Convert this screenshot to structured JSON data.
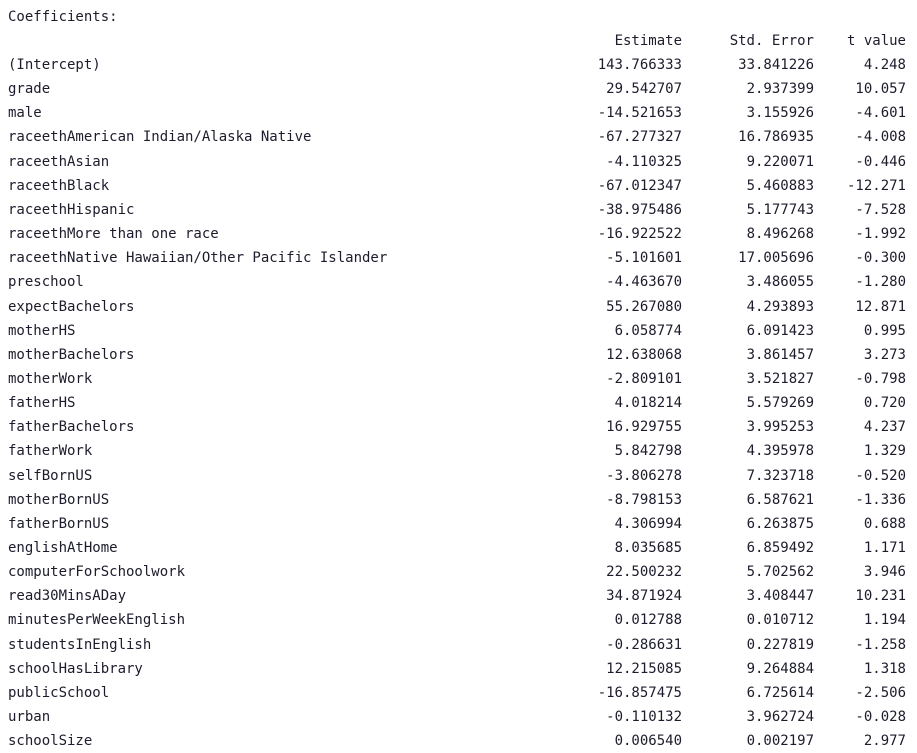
{
  "output": {
    "heading": "Coefficients:",
    "columns": {
      "estimate": "Estimate",
      "std_error": "Std. Error",
      "t_value": "t value"
    },
    "rows": [
      {
        "term": "(Intercept)",
        "estimate": "143.766333",
        "std_error": "33.841226",
        "t_value": "4.248"
      },
      {
        "term": "grade",
        "estimate": "29.542707",
        "std_error": "2.937399",
        "t_value": "10.057"
      },
      {
        "term": "male",
        "estimate": "-14.521653",
        "std_error": "3.155926",
        "t_value": "-4.601"
      },
      {
        "term": "raceethAmerican Indian/Alaska Native",
        "estimate": "-67.277327",
        "std_error": "16.786935",
        "t_value": "-4.008"
      },
      {
        "term": "raceethAsian",
        "estimate": "-4.110325",
        "std_error": "9.220071",
        "t_value": "-0.446"
      },
      {
        "term": "raceethBlack",
        "estimate": "-67.012347",
        "std_error": "5.460883",
        "t_value": "-12.271"
      },
      {
        "term": "raceethHispanic",
        "estimate": "-38.975486",
        "std_error": "5.177743",
        "t_value": "-7.528"
      },
      {
        "term": "raceethMore than one race",
        "estimate": "-16.922522",
        "std_error": "8.496268",
        "t_value": "-1.992"
      },
      {
        "term": "raceethNative Hawaiian/Other Pacific Islander",
        "estimate": "-5.101601",
        "std_error": "17.005696",
        "t_value": "-0.300"
      },
      {
        "term": "preschool",
        "estimate": "-4.463670",
        "std_error": "3.486055",
        "t_value": "-1.280"
      },
      {
        "term": "expectBachelors",
        "estimate": "55.267080",
        "std_error": "4.293893",
        "t_value": "12.871"
      },
      {
        "term": "motherHS",
        "estimate": "6.058774",
        "std_error": "6.091423",
        "t_value": "0.995"
      },
      {
        "term": "motherBachelors",
        "estimate": "12.638068",
        "std_error": "3.861457",
        "t_value": "3.273"
      },
      {
        "term": "motherWork",
        "estimate": "-2.809101",
        "std_error": "3.521827",
        "t_value": "-0.798"
      },
      {
        "term": "fatherHS",
        "estimate": "4.018214",
        "std_error": "5.579269",
        "t_value": "0.720"
      },
      {
        "term": "fatherBachelors",
        "estimate": "16.929755",
        "std_error": "3.995253",
        "t_value": "4.237"
      },
      {
        "term": "fatherWork",
        "estimate": "5.842798",
        "std_error": "4.395978",
        "t_value": "1.329"
      },
      {
        "term": "selfBornUS",
        "estimate": "-3.806278",
        "std_error": "7.323718",
        "t_value": "-0.520"
      },
      {
        "term": "motherBornUS",
        "estimate": "-8.798153",
        "std_error": "6.587621",
        "t_value": "-1.336"
      },
      {
        "term": "fatherBornUS",
        "estimate": "4.306994",
        "std_error": "6.263875",
        "t_value": "0.688"
      },
      {
        "term": "englishAtHome",
        "estimate": "8.035685",
        "std_error": "6.859492",
        "t_value": "1.171"
      },
      {
        "term": "computerForSchoolwork",
        "estimate": "22.500232",
        "std_error": "5.702562",
        "t_value": "3.946"
      },
      {
        "term": "read30MinsADay",
        "estimate": "34.871924",
        "std_error": "3.408447",
        "t_value": "10.231"
      },
      {
        "term": "minutesPerWeekEnglish",
        "estimate": "0.012788",
        "std_error": "0.010712",
        "t_value": "1.194"
      },
      {
        "term": "studentsInEnglish",
        "estimate": "-0.286631",
        "std_error": "0.227819",
        "t_value": "-1.258"
      },
      {
        "term": "schoolHasLibrary",
        "estimate": "12.215085",
        "std_error": "9.264884",
        "t_value": "1.318"
      },
      {
        "term": "publicSchool",
        "estimate": "-16.857475",
        "std_error": "6.725614",
        "t_value": "-2.506"
      },
      {
        "term": "urban",
        "estimate": "-0.110132",
        "std_error": "3.962724",
        "t_value": "-0.028"
      },
      {
        "term": "schoolSize",
        "estimate": "0.006540",
        "std_error": "0.002197",
        "t_value": "2.977"
      }
    ]
  }
}
